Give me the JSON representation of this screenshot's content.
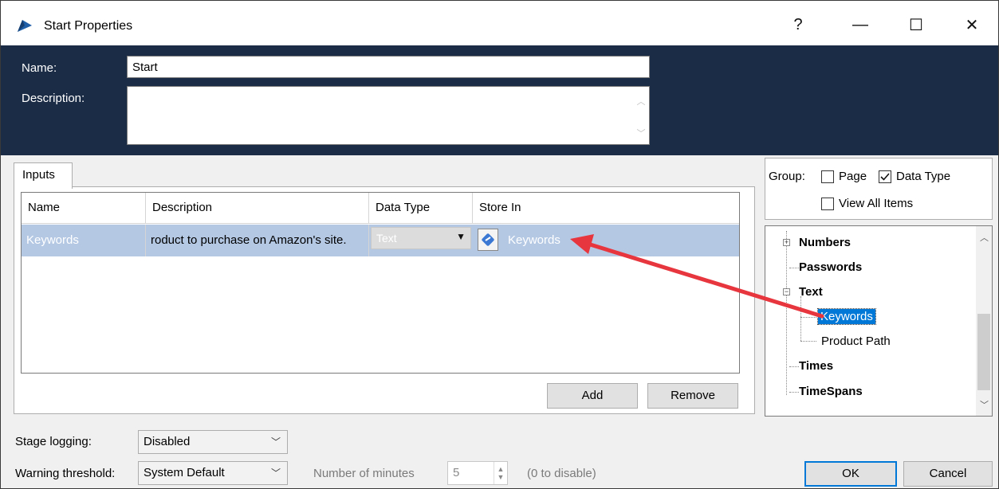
{
  "window": {
    "title": "Start Properties",
    "help_glyph": "?",
    "minimize_glyph": "—",
    "maximize_glyph": "☐",
    "close_glyph": "✕"
  },
  "header": {
    "name_label": "Name:",
    "name_value": "Start",
    "description_label": "Description:",
    "description_value": ""
  },
  "tabs": [
    {
      "label": "Inputs"
    }
  ],
  "inputs_grid": {
    "columns": [
      "Name",
      "Description",
      "Data Type",
      "Store In"
    ],
    "rows": [
      {
        "name": "Keywords",
        "description": "roduct to purchase on Amazon's site.",
        "data_type": "Text",
        "store_in": "Keywords"
      }
    ],
    "add_label": "Add",
    "remove_label": "Remove"
  },
  "group": {
    "label": "Group:",
    "options": [
      {
        "label": "Page",
        "checked": false
      },
      {
        "label": "Data Type",
        "checked": true
      },
      {
        "label": "View All Items",
        "checked": false
      }
    ]
  },
  "tree": {
    "items": [
      {
        "label": "Numbers",
        "bold": true,
        "expander": "+"
      },
      {
        "label": "Passwords",
        "bold": true
      },
      {
        "label": "Text",
        "bold": true,
        "expander": "−"
      },
      {
        "label": "Keywords",
        "bold": false,
        "selected": true
      },
      {
        "label": "Product Path",
        "bold": false
      },
      {
        "label": "Times",
        "bold": true
      },
      {
        "label": "TimeSpans",
        "bold": true
      }
    ]
  },
  "footer": {
    "stage_logging_label": "Stage logging:",
    "stage_logging_value": "Disabled",
    "warning_threshold_label": "Warning threshold:",
    "warning_threshold_value": "System Default",
    "minutes_label": "Number of minutes",
    "minutes_value": "5",
    "minutes_hint": "(0 to disable)",
    "ok_label": "OK",
    "cancel_label": "Cancel"
  },
  "colors": {
    "header_bg": "#1b2c46",
    "selected_row": "#b4c8e4",
    "tree_selected": "#0078d7",
    "arrow": "#e8363e"
  },
  "icons": {
    "app": "blueprism-logo-icon",
    "store_in": "data-item-icon"
  }
}
